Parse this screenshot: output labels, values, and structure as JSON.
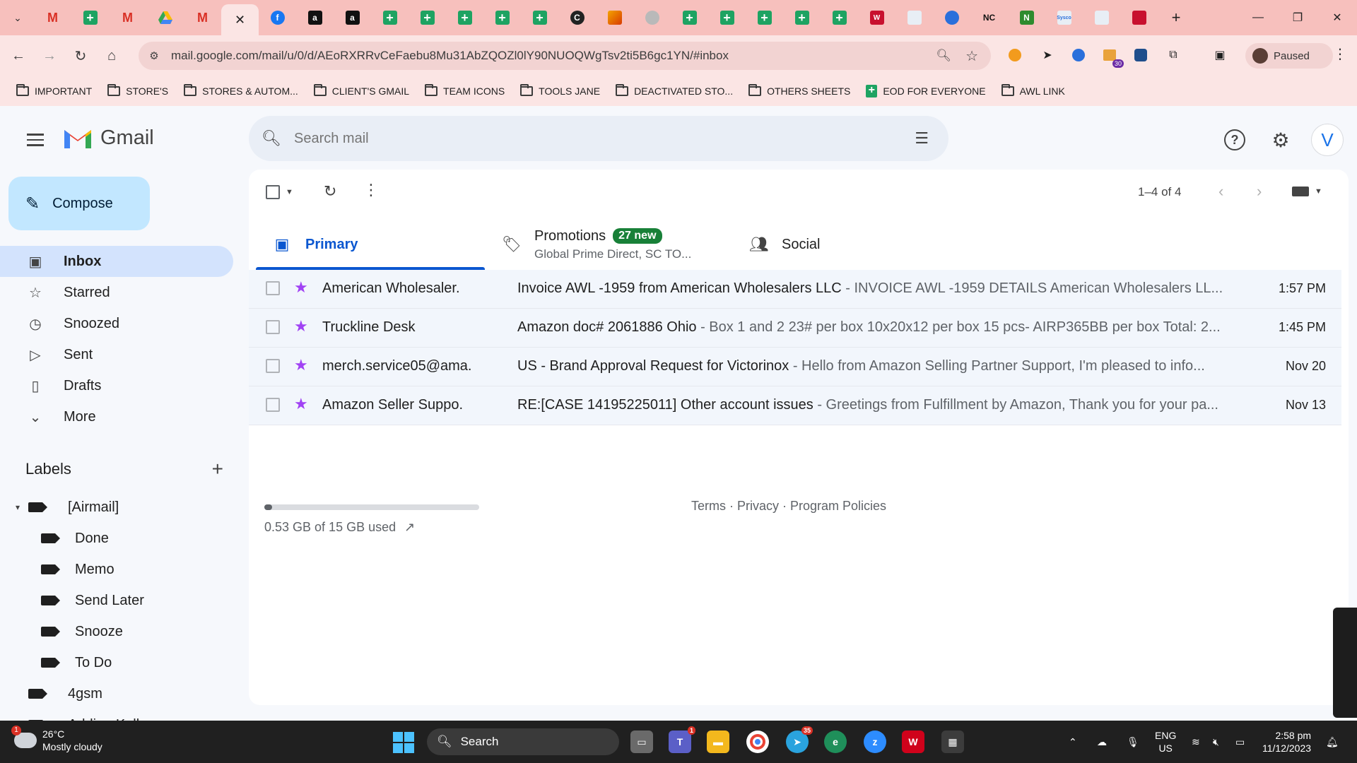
{
  "browser": {
    "url": "mail.google.com/mail/u/0/d/AEoRXRRvCeFaebu8Mu31AbZQOZl0lY90NUOQWgTsv2ti5B6gc1YN/#inbox",
    "profile_label": "Paused",
    "extension_badge": "30",
    "tabs": [
      {
        "icon": "gmail-icon",
        "text": "M"
      },
      {
        "icon": "sheets-icon",
        "text": ""
      },
      {
        "icon": "gmail-icon",
        "text": "M"
      },
      {
        "icon": "drive-icon",
        "text": ""
      },
      {
        "icon": "gmail-icon",
        "text": "M"
      },
      {
        "icon": "active-tab",
        "text": ""
      },
      {
        "icon": "facebook-icon",
        "text": "f"
      },
      {
        "icon": "amazon-icon",
        "text": "a"
      },
      {
        "icon": "amazon-icon",
        "text": "a"
      },
      {
        "icon": "sheets-icon",
        "text": ""
      },
      {
        "icon": "sheets-icon",
        "text": ""
      },
      {
        "icon": "sheets-icon",
        "text": ""
      },
      {
        "icon": "sheets-icon",
        "text": ""
      },
      {
        "icon": "sheets-icon",
        "text": ""
      },
      {
        "icon": "c-icon",
        "text": "C"
      },
      {
        "icon": "zapier-icon",
        "text": ""
      },
      {
        "icon": "globe-icon",
        "text": ""
      },
      {
        "icon": "sheets-icon",
        "text": ""
      },
      {
        "icon": "sheets-icon",
        "text": ""
      },
      {
        "icon": "sheets-icon",
        "text": ""
      },
      {
        "icon": "sheets-icon",
        "text": ""
      },
      {
        "icon": "sheets-icon",
        "text": ""
      },
      {
        "icon": "ww-icon",
        "text": "W"
      },
      {
        "icon": "cloud-icon",
        "text": ""
      },
      {
        "icon": "swoosh-icon",
        "text": ""
      },
      {
        "icon": "nc-icon",
        "text": "NC"
      },
      {
        "icon": "n-icon",
        "text": "N"
      },
      {
        "icon": "sysco-icon",
        "text": "Sysco"
      },
      {
        "icon": "seal-icon",
        "text": ""
      },
      {
        "icon": "shield-icon",
        "text": ""
      }
    ],
    "bookmarks": [
      {
        "type": "folder",
        "label": "IMPORTANT"
      },
      {
        "type": "folder",
        "label": "STORE'S"
      },
      {
        "type": "folder",
        "label": "STORES & AUTOM..."
      },
      {
        "type": "folder",
        "label": "CLIENT'S GMAIL"
      },
      {
        "type": "folder",
        "label": "TEAM ICONS"
      },
      {
        "type": "folder",
        "label": "TOOLS JANE"
      },
      {
        "type": "folder",
        "label": "DEACTIVATED STO..."
      },
      {
        "type": "folder",
        "label": "OTHERS SHEETS"
      },
      {
        "type": "sheet",
        "label": "EOD FOR EVERYONE"
      },
      {
        "type": "folder",
        "label": "AWL LINK"
      }
    ]
  },
  "gmail": {
    "app_name": "Gmail",
    "search_placeholder": "Search mail",
    "avatar_letter": "V",
    "compose_label": "Compose",
    "nav": [
      {
        "icon": "inbox-icon",
        "label": "Inbox",
        "active": true
      },
      {
        "icon": "star-icon",
        "label": "Starred",
        "active": false
      },
      {
        "icon": "clock-icon",
        "label": "Snoozed",
        "active": false
      },
      {
        "icon": "send-icon",
        "label": "Sent",
        "active": false
      },
      {
        "icon": "draft-icon",
        "label": "Drafts",
        "active": false
      },
      {
        "icon": "chevron-down-icon",
        "label": "More",
        "active": false
      }
    ],
    "labels_title": "Labels",
    "labels": [
      {
        "label": "[Airmail]",
        "indent": 0,
        "expanded": true
      },
      {
        "label": "Done",
        "indent": 1
      },
      {
        "label": "Memo",
        "indent": 1
      },
      {
        "label": "Send Later",
        "indent": 1
      },
      {
        "label": "Snooze",
        "indent": 1
      },
      {
        "label": "To Do",
        "indent": 1
      },
      {
        "label": "4gsm",
        "indent": 0
      },
      {
        "label": "Adding Kell...",
        "indent": 0
      }
    ],
    "pagination": "1–4 of 4",
    "categories": {
      "primary": "Primary",
      "promotions": "Promotions",
      "promotions_badge": "27 new",
      "promotions_sub": "Global Prime Direct, SC TO...",
      "social": "Social"
    },
    "emails": [
      {
        "sender": "American Wholesaler.",
        "subject": "Invoice AWL -1959 from American Wholesalers LLC",
        "snippet": " - INVOICE AWL -1959 DETAILS American Wholesalers LL...",
        "time": "1:57 PM"
      },
      {
        "sender": "Truckline Desk",
        "subject": "Amazon doc# 2061886 Ohio",
        "snippet": " - Box 1 and 2 23# per box 10x20x12 per box 15 pcs- AIRP365BB per box Total: 2...",
        "time": "1:45 PM"
      },
      {
        "sender": "merch.service05@ama.",
        "subject": "US - Brand Approval Request for Victorinox",
        "snippet": " - Hello from Amazon Selling Partner Support, I'm pleased to info...",
        "time": "Nov 20"
      },
      {
        "sender": "Amazon Seller Suppo.",
        "subject": "RE:[CASE 14195225011] Other account issues",
        "snippet": " - Greetings from Fulfillment by Amazon, Thank you for your pa...",
        "time": "Nov 13"
      }
    ],
    "storage": {
      "text": "0.53 GB of 15 GB used",
      "used_fraction": 0.035
    },
    "footer": "Terms · Privacy · Program Policies"
  },
  "taskbar": {
    "weather_temp": "26°C",
    "weather_desc": "Mostly cloudy",
    "weather_badge": "1",
    "search_label": "Search",
    "teams_badge": "1",
    "telegram_badge": "35",
    "lang_top": "ENG",
    "lang_bottom": "US",
    "time": "2:58 pm",
    "date": "11/12/2023"
  },
  "colors": {
    "tab_strip": "#f7c0bd",
    "toolbar": "#fbe5e4",
    "accent": "#0b57d0",
    "compose": "#c2e7ff",
    "nav_active": "#d3e3fd",
    "promo_badge": "#188038",
    "star": "#a142f4"
  }
}
